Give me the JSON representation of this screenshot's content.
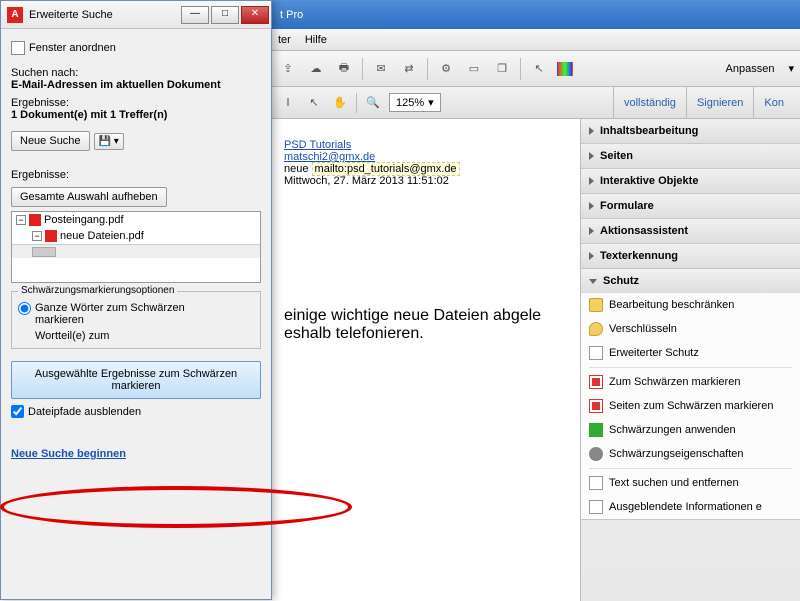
{
  "search_dialog": {
    "title": "Erweiterte Suche",
    "arrange": "Fenster anordnen",
    "search_for_label": "Suchen nach:",
    "search_for_value": "E-Mail-Adressen im aktuellen Dokument",
    "results_label": "Ergebnisse:",
    "results_value": "1 Dokument(e) mit 1 Treffer(n)",
    "new_search": "Neue Suche",
    "results2": "Ergebnisse:",
    "deselect_all": "Gesamte Auswahl aufheben",
    "tree": {
      "file1": "Posteingang.pdf",
      "file2": "neue Dateien.pdf"
    },
    "redact_group": "Schwärzungsmarkierungsoptionen",
    "radio1": "Ganze Wörter zum Schwärzen markieren",
    "radio2": "Wortteil(e) zum",
    "mark_button": "Ausgewählte Ergebnisse zum Schwärzen markieren",
    "hide_paths": "Dateipfade ausblenden",
    "start_new": "Neue Suche beginnen"
  },
  "app": {
    "title_suffix": "t Pro",
    "menu": {
      "item1": "ter",
      "help": "Hilfe"
    },
    "customize": "Anpassen",
    "zoom": "125%",
    "tabs": {
      "full": "vollständig",
      "sign": "Signieren",
      "comment": "Kon"
    }
  },
  "document": {
    "sender": "PSD Tutorials",
    "email": "matschi2@gmx.de",
    "new_prefix": "neue",
    "mailto": "mailto:psd_tutorials@gmx.de",
    "date": "Mittwoch, 27. März 2013 11:51:02",
    "body_line1": "einige wichtige neue Dateien abgele",
    "body_line2": "eshalb telefonieren."
  },
  "panel": {
    "content_edit": "Inhaltsbearbeitung",
    "pages": "Seiten",
    "interactive": "Interaktive Objekte",
    "forms": "Formulare",
    "action_wizard": "Aktionsassistent",
    "text_recog": "Texterkennung",
    "security": "Schutz",
    "items": {
      "restrict": "Bearbeitung beschränken",
      "encrypt": "Verschlüsseln",
      "advanced": "Erweiterter Schutz",
      "mark_redact": "Zum Schwärzen markieren",
      "mark_pages": "Seiten zum Schwärzen markieren",
      "apply": "Schwärzungen anwenden",
      "props": "Schwärzungseigenschaften",
      "search_remove": "Text suchen und entfernen",
      "remove_hidden": "Ausgeblendete Informationen e"
    }
  }
}
